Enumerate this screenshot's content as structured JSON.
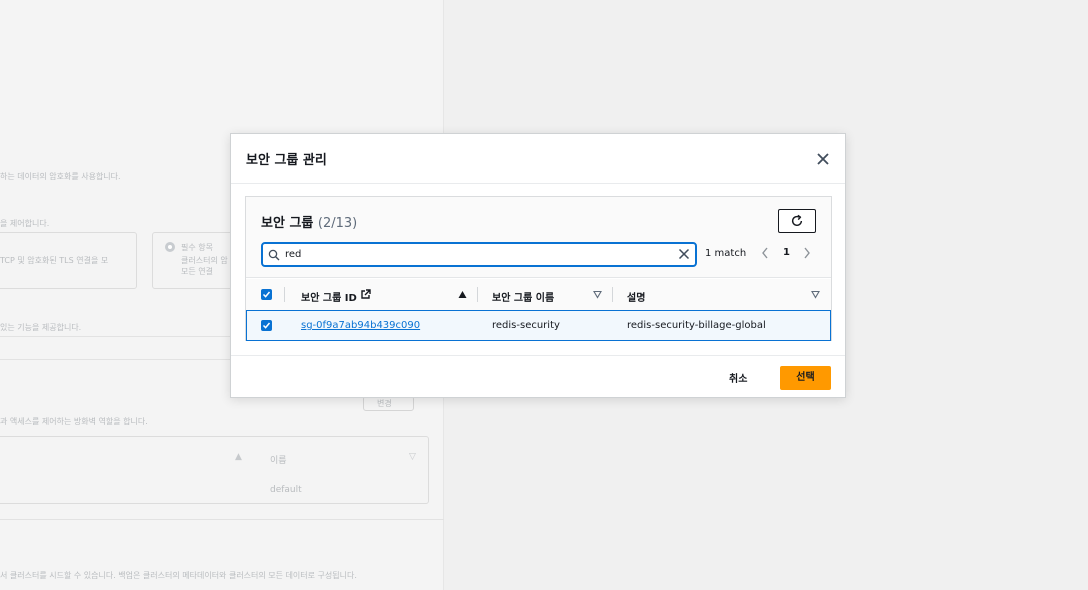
{
  "background": {
    "texts": [
      "하는 데이터의 암호화를 사용합니다.",
      "을 제어합니다.",
      "TCP 및 암호화된 TLS 연결을 모",
      "필수 항목",
      "클러스터의 암",
      "모든 연결",
      "있는 기능을 제공합니다.",
      "변경",
      "과 액세스를 제어하는 방화벽 역할을 합니다.",
      "이름",
      "default",
      "서 클러스터를 시드할 수 있습니다. 백업은 클러스터의 메타데이터와 클러스터의 모든 데이터로 구성됩니다."
    ]
  },
  "modal": {
    "title": "보안 그룹 관리",
    "section_title": "보안 그룹",
    "section_count": "(2/13)",
    "search": {
      "value": "red"
    },
    "match_text": "1 match",
    "page": "1",
    "columns": [
      "보안 그룹 ID",
      "보안 그룹 이름",
      "설명"
    ],
    "rows": [
      {
        "id": "sg-0f9a7ab94b439c090",
        "name": "redis-security",
        "description": "redis-security-billage-global",
        "selected": true
      }
    ],
    "cancel_label": "취소",
    "select_label": "선택"
  },
  "colors": {
    "primary": "#0972d3",
    "accent": "#ff9900"
  }
}
